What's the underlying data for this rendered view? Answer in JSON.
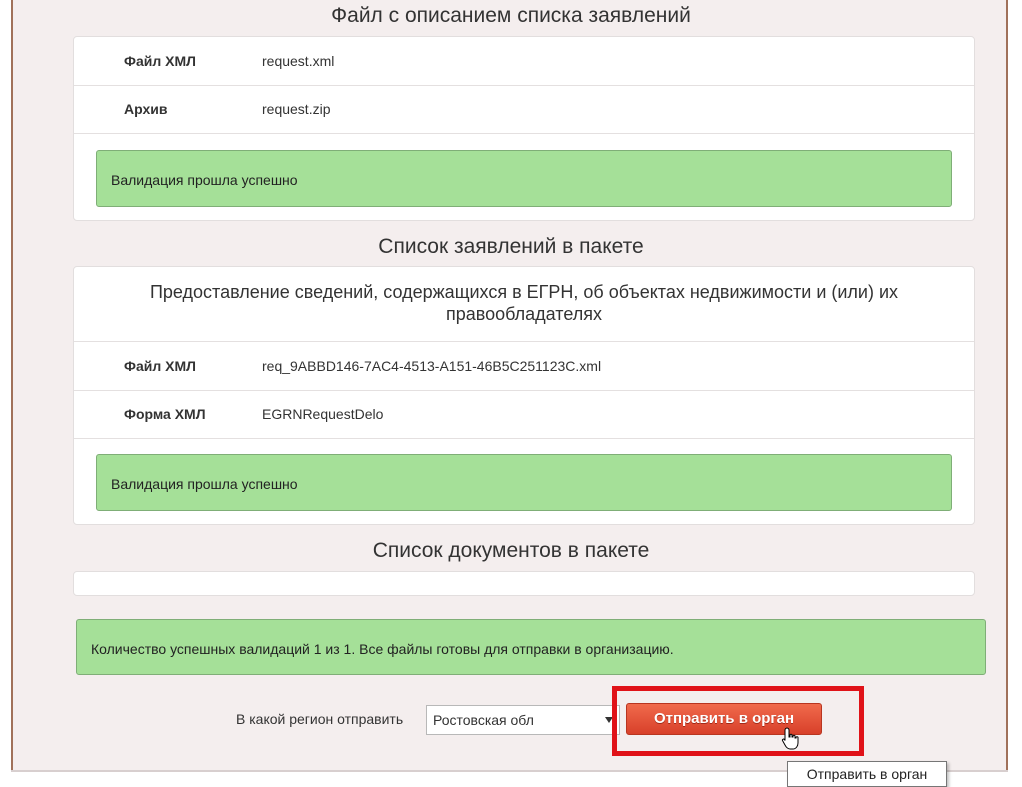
{
  "section1": {
    "title": "Файл с описанием списка заявлений",
    "rows": [
      {
        "label": "Файл ХМЛ",
        "value": "request.xml"
      },
      {
        "label": "Архив",
        "value": "request.zip"
      }
    ],
    "validation": "Валидация прошла успешно"
  },
  "section2": {
    "title": "Список заявлений в пакете",
    "request_title": "Предоставление сведений, содержащихся в ЕГРН, об объектах недвижимости и (или) их правообладателях",
    "rows": [
      {
        "label": "Файл ХМЛ",
        "value": "req_9ABBD146-7AC4-4513-A151-46B5C251123C.xml"
      },
      {
        "label": "Форма ХМЛ",
        "value": "EGRNRequestDelo"
      }
    ],
    "validation": "Валидация прошла успешно"
  },
  "section3": {
    "title": "Список документов в пакете"
  },
  "summary": "Количество успешных валидаций 1 из 1. Все файлы готовы для отправки в организацию.",
  "send_form": {
    "region_label": "В какой регион отправить",
    "region_selected": "Ростовская обл",
    "send_button": "Отправить в орган",
    "tooltip": "Отправить в орган"
  },
  "colors": {
    "success_bg": "#a5e098",
    "button": "#e8553a",
    "highlight": "#e01218"
  }
}
